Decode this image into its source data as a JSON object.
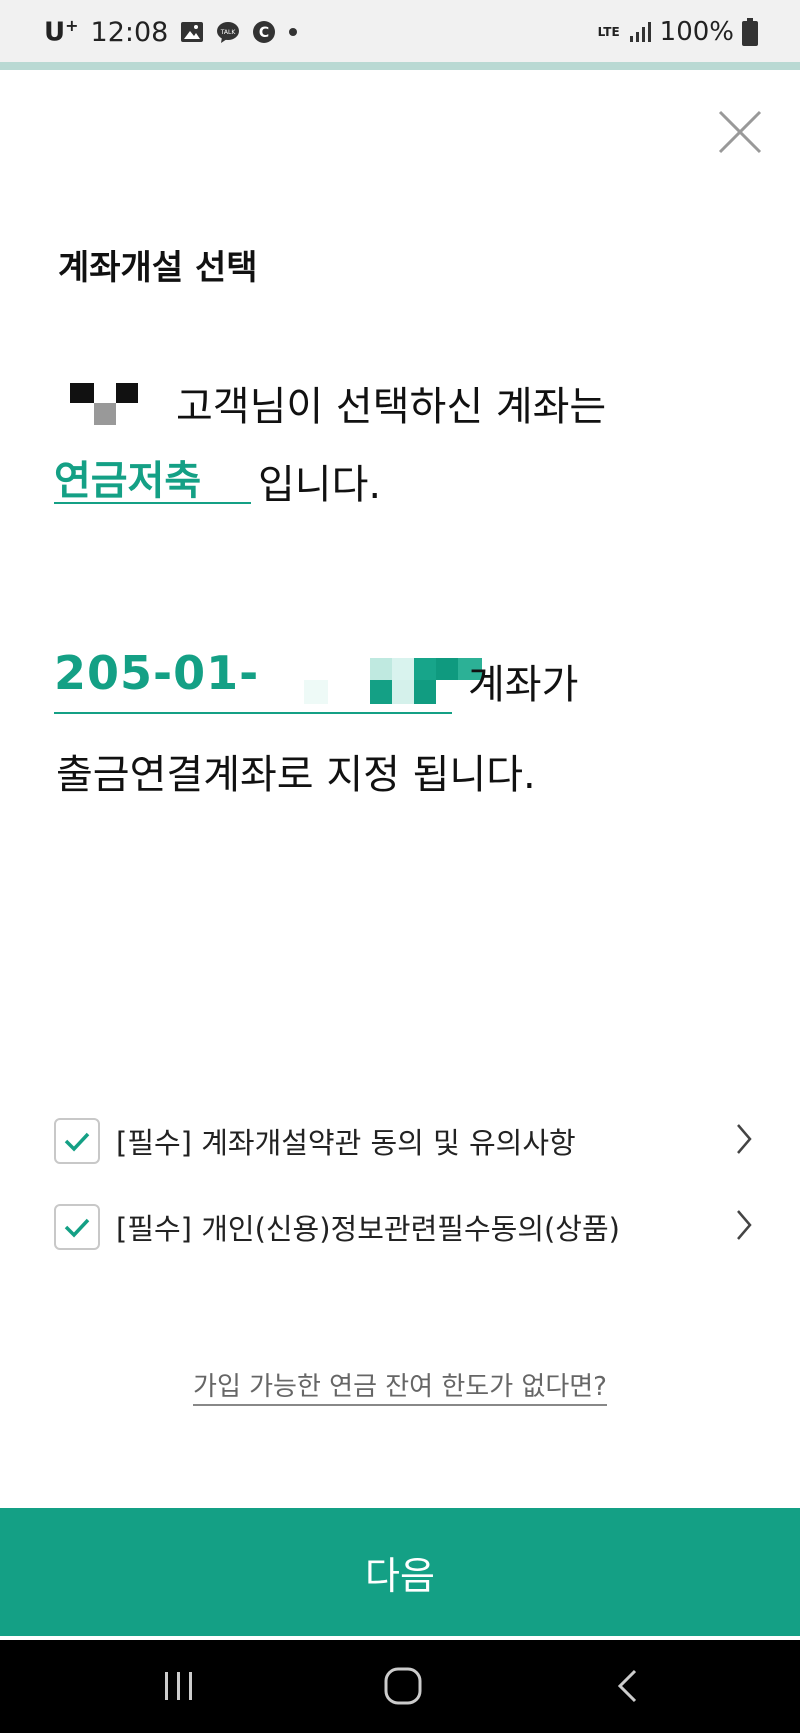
{
  "status_bar": {
    "carrier": "U",
    "carrier_sup": "+",
    "time": "12:08",
    "network": "LTE",
    "battery": "100%"
  },
  "screen": {
    "title": "계좌개설 선택",
    "line1": "고객님이 선택하신 계좌는",
    "product": "연금저축",
    "line2_suffix": "입니다.",
    "account_prefix": "205-01-",
    "account_suffix": "계좌가",
    "line4": "출금연결계좌로 지정 됩니다."
  },
  "agreements": [
    {
      "label": "[필수] 계좌개설약관 동의 및 유의사항",
      "checked": true
    },
    {
      "label": "[필수] 개인(신용)정보관련필수동의(상품)",
      "checked": true
    }
  ],
  "limit_link": "가입 가능한 연금 잔여 한도가 없다면?",
  "next_button": "다음",
  "colors": {
    "accent": "#14a085",
    "status_bg": "#f1f1f1",
    "teal_line": "#b9d9d3"
  },
  "icons": [
    "gallery-icon",
    "kakaotalk-icon",
    "c-app-icon",
    "signal-icon",
    "battery-icon",
    "close-icon",
    "check-icon",
    "chevron-right-icon",
    "recent-apps-icon",
    "home-icon",
    "back-icon"
  ]
}
